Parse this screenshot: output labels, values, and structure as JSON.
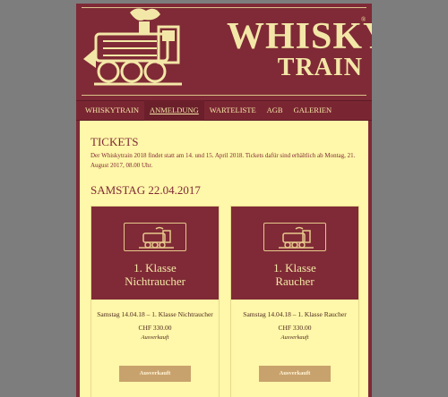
{
  "brand": {
    "line1": "WHISKY",
    "line2": "TRAIN",
    "registered": "®"
  },
  "nav": [
    {
      "label": "WHISKYTRAIN"
    },
    {
      "label": "ANMELDUNG",
      "active": true
    },
    {
      "label": "WARTELISTE"
    },
    {
      "label": "AGB"
    },
    {
      "label": "GALERIEN"
    }
  ],
  "tickets": {
    "title": "TICKETS",
    "intro": "Der Whiskytrain 2018 findet statt am 14. und 15. April 2018. Tickets dafür sind erhältlich ab Montag, 21. August 2017, 08.00 Uhr.",
    "day": "SAMSTAG 22.04.2017"
  },
  "cards": [
    {
      "class_line1": "1. Klasse",
      "class_line2": "Nichtraucher",
      "description": "Samstag 14.04.18 – 1. Klasse Nichtraucher",
      "price": "CHF 330.00",
      "status": "Ausverkauft",
      "button": "Ausverkauft"
    },
    {
      "class_line1": "1. Klasse",
      "class_line2": "Raucher",
      "description": "Samstag 14.04.18 – 1. Klasse Raucher",
      "price": "CHF 330.00",
      "status": "Ausverkauft",
      "button": "Ausverkauft"
    }
  ],
  "colors": {
    "brand": "#7f2a36",
    "cream": "#fff7a9",
    "button": "#c8a26d"
  }
}
